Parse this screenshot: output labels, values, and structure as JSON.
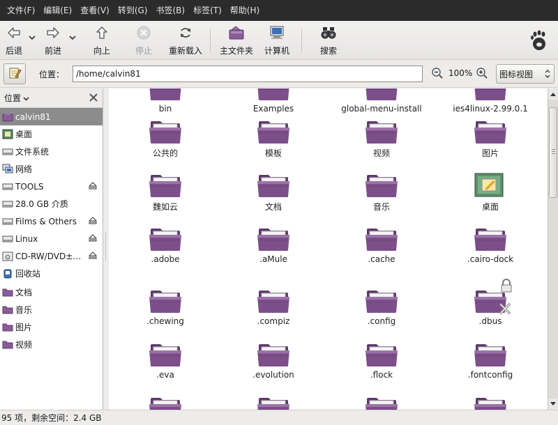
{
  "menu": [
    "文件(F)",
    "编辑(E)",
    "查看(V)",
    "转到(G)",
    "书签(B)",
    "标签(T)",
    "帮助(H)"
  ],
  "toolbar": {
    "back": "后退",
    "forward": "前进",
    "up": "向上",
    "stop": "停止",
    "reload": "重新载入",
    "home": "主文件夹",
    "computer": "计算机",
    "search": "搜索"
  },
  "location": {
    "label": "位置：",
    "path": "/home/calvin81",
    "zoom": "100%",
    "view_mode": "图标视图"
  },
  "sidebar": {
    "header": "位置",
    "items": [
      {
        "label": "calvin81",
        "icon": "home-folder-icon",
        "selected": true
      },
      {
        "label": "桌面",
        "icon": "desktop-icon"
      },
      {
        "label": "文件系统",
        "icon": "drive-icon"
      },
      {
        "label": "网络",
        "icon": "network-icon"
      },
      {
        "label": "TOOLS",
        "icon": "drive-icon",
        "eject": true
      },
      {
        "label": "28.0 GB 介质",
        "icon": "drive-icon"
      },
      {
        "label": "Films & Others",
        "icon": "drive-icon",
        "eject": true
      },
      {
        "label": "Linux",
        "icon": "drive-icon",
        "eject": true
      },
      {
        "label": "CD-RW/DVD±RW",
        "icon": "optical-drive-icon",
        "eject": true
      },
      {
        "label": "回收站",
        "icon": "trash-icon"
      },
      {
        "label": "文档",
        "icon": "folder-icon"
      },
      {
        "label": "音乐",
        "icon": "folder-icon"
      },
      {
        "label": "图片",
        "icon": "folder-icon"
      },
      {
        "label": "视频",
        "icon": "folder-icon"
      }
    ]
  },
  "files": [
    {
      "name": "bin"
    },
    {
      "name": "Examples"
    },
    {
      "name": "global-menu-install"
    },
    {
      "name": "ies4linux-2.99.0.1"
    },
    {
      "name": "公共的"
    },
    {
      "name": "模板"
    },
    {
      "name": "视频"
    },
    {
      "name": "图片"
    },
    {
      "name": "魏如云"
    },
    {
      "name": "文档"
    },
    {
      "name": "音乐"
    },
    {
      "name": "桌面"
    },
    {
      "name": ".adobe"
    },
    {
      "name": ".aMule"
    },
    {
      "name": ".cache"
    },
    {
      "name": ".cairo-dock"
    },
    {
      "name": ".chewing"
    },
    {
      "name": ".compiz"
    },
    {
      "name": ".config"
    },
    {
      "name": ".dbus"
    },
    {
      "name": ".eva"
    },
    {
      "name": ".evolution"
    },
    {
      "name": ".flock"
    },
    {
      "name": ".fontconfig"
    }
  ],
  "status": "95 项，剩余空间：2.4 GB",
  "colors": {
    "folder": "#7d4f8a",
    "folder_dark": "#5e3a6b",
    "selection": "#8c8c8c",
    "menubar": "#2b2b2b"
  }
}
